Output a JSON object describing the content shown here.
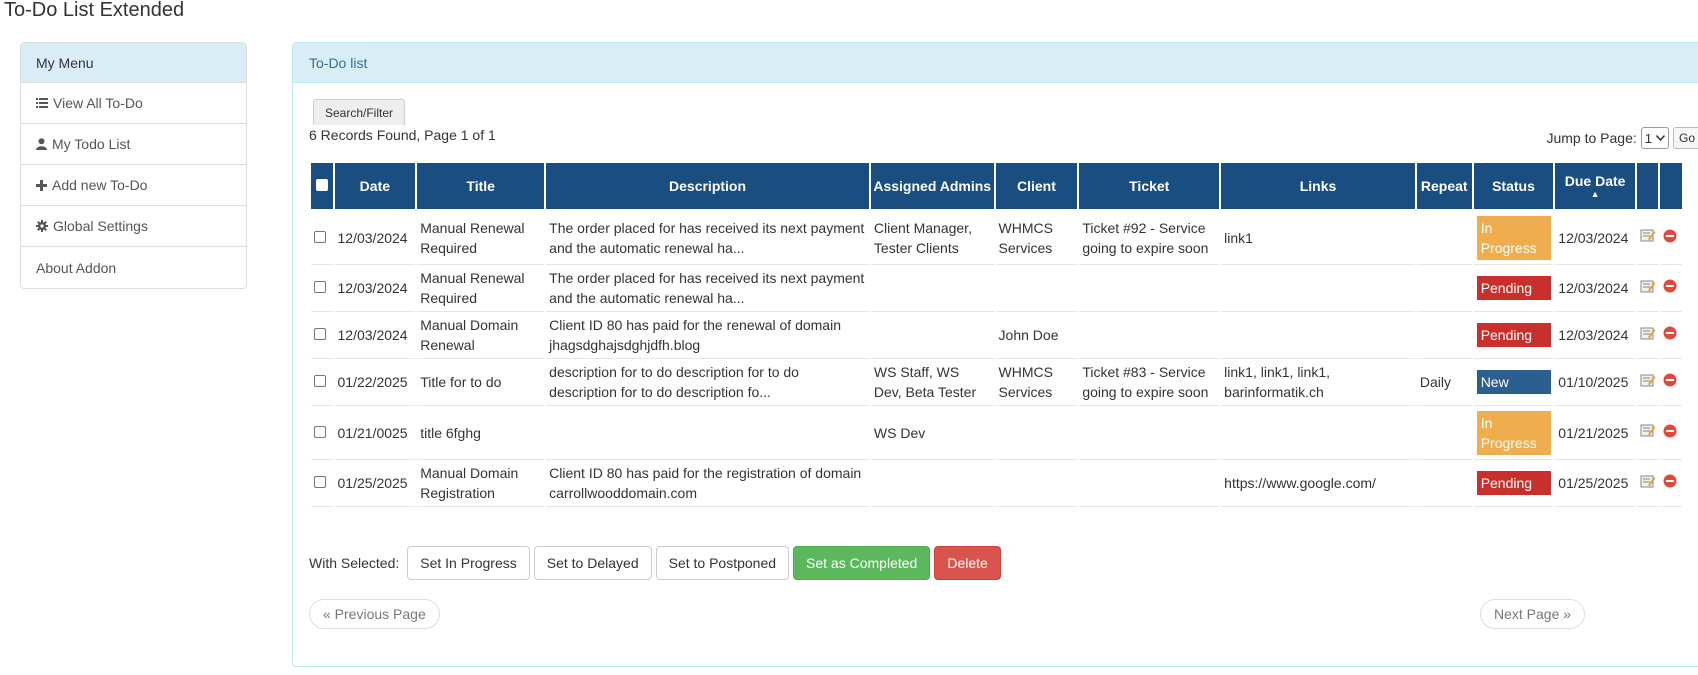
{
  "page": {
    "title": "To-Do List Extended"
  },
  "sidebar": {
    "header": "My Menu",
    "items": [
      {
        "label": "View All To-Do",
        "icon": "list-icon"
      },
      {
        "label": "My Todo List",
        "icon": "user-icon"
      },
      {
        "label": "Add new To-Do",
        "icon": "plus-icon"
      },
      {
        "label": "Global Settings",
        "icon": "gear-icon"
      },
      {
        "label": "About Addon",
        "icon": ""
      }
    ]
  },
  "panel": {
    "heading": "To-Do list",
    "search_tab": "Search/Filter",
    "records": "6 Records Found, Page 1 of 1",
    "jump_label": "Jump to Page:",
    "jump_value": "1",
    "go_label": "Go"
  },
  "table": {
    "headers": {
      "date": "Date",
      "title": "Title",
      "description": "Description",
      "admins": "Assigned Admins",
      "client": "Client",
      "ticket": "Ticket",
      "links": "Links",
      "repeat": "Repeat",
      "status": "Status",
      "due": "Due Date"
    },
    "rows": [
      {
        "date": "12/03/2024",
        "title": "Manual Renewal Required",
        "description": "The order placed for has received its next payment and the automatic renewal ha...",
        "admins": "Client Manager, Tester Clients",
        "client": "WHMCS Services",
        "ticket": "Ticket #92 - Service going to expire soon",
        "links": "link1",
        "repeat": "",
        "status": "In Progress",
        "status_kind": "progress",
        "due": "12/03/2024"
      },
      {
        "date": "12/03/2024",
        "title": "Manual Renewal Required",
        "description": "The order placed for has received its next payment and the automatic renewal ha...",
        "admins": "",
        "client": "",
        "ticket": "",
        "links": "",
        "repeat": "",
        "status": "Pending",
        "status_kind": "pending",
        "due": "12/03/2024"
      },
      {
        "date": "12/03/2024",
        "title": "Manual Domain Renewal",
        "description": "Client ID 80 has paid for the renewal of domain jhagsdghajsdghjdfh.blog",
        "admins": "",
        "client": "John Doe",
        "ticket": "",
        "links": "",
        "repeat": "",
        "status": "Pending",
        "status_kind": "pending",
        "due": "12/03/2024"
      },
      {
        "date": "01/22/2025",
        "title": "Title for to do",
        "description": "description for to do description for to do description for to do description fo...",
        "admins": "WS Staff, WS Dev, Beta Tester",
        "client": "WHMCS Services",
        "ticket": "Ticket #83 - Service going to expire soon",
        "links": "link1, link1, link1, barinformatik.ch",
        "repeat": "Daily",
        "status": "New",
        "status_kind": "new",
        "due": "01/10/2025"
      },
      {
        "date": "01/21/0025",
        "title": "title 6fghg",
        "description": "",
        "admins": "WS Dev",
        "client": "",
        "ticket": "",
        "links": "",
        "repeat": "",
        "status": "In Progress",
        "status_kind": "progress",
        "due": "01/21/2025"
      },
      {
        "date": "01/25/2025",
        "title": "Manual Domain Registration",
        "description": "Client ID 80 has paid for the registration of domain carrollwooddomain.com",
        "admins": "",
        "client": "",
        "ticket": "",
        "links": "https://www.google.com/",
        "repeat": "",
        "status": "Pending",
        "status_kind": "pending",
        "due": "01/25/2025"
      }
    ]
  },
  "bulk": {
    "label": "With Selected:",
    "buttons": [
      "Set In Progress",
      "Set to Delayed",
      "Set to Postponed",
      "Set as Completed",
      "Delete"
    ]
  },
  "pager": {
    "prev": "« Previous Page",
    "next": "Next Page »"
  },
  "colors": {
    "header_bg": "#1a4d80",
    "panel_heading_bg": "#d9edf7",
    "status_progress": "#f0ad4e",
    "status_pending": "#c9302c",
    "status_new": "#2a5f8f",
    "success": "#5cb85c",
    "danger": "#d9534f"
  }
}
